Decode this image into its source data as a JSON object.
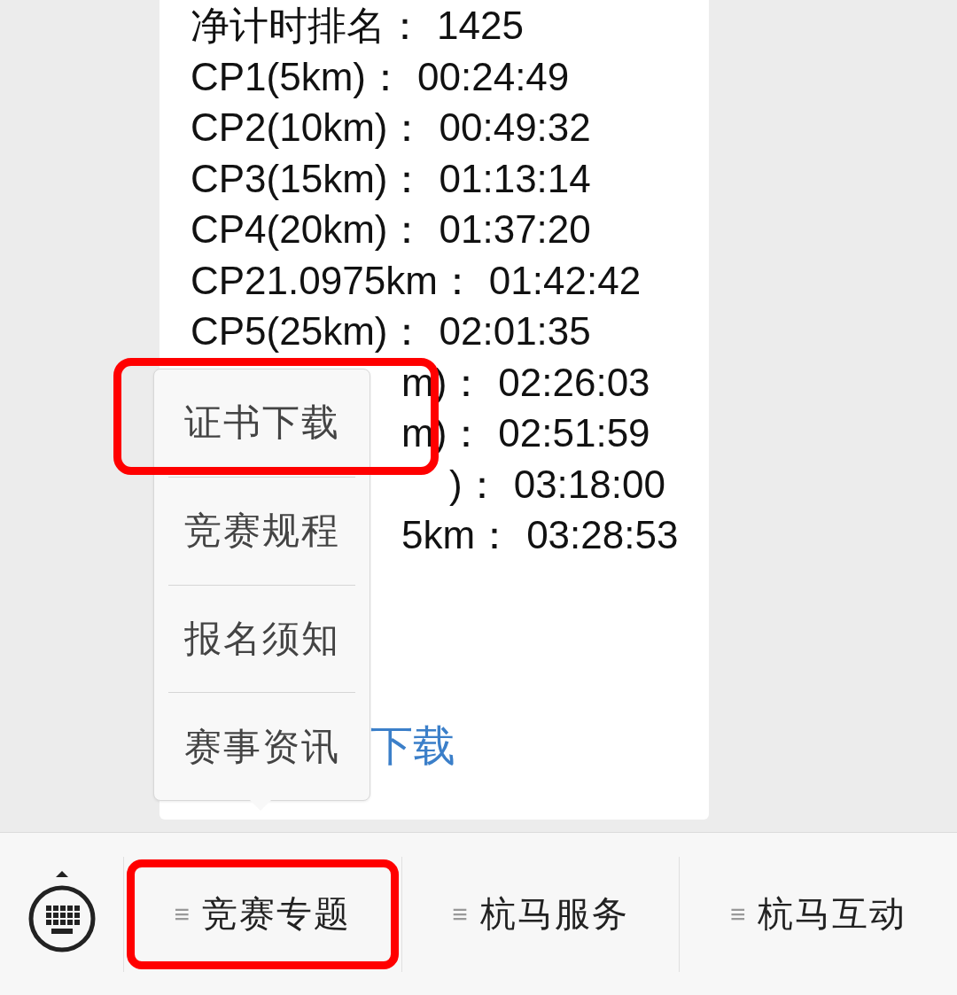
{
  "message": {
    "lines": [
      {
        "kind": "full",
        "label": "净计时排名：",
        "value": "1425"
      },
      {
        "kind": "full",
        "label": "CP1(5km)：",
        "value": "00:24:49"
      },
      {
        "kind": "full",
        "label": "CP2(10km)：",
        "value": "00:49:32"
      },
      {
        "kind": "full",
        "label": "CP3(15km)：",
        "value": "01:13:14"
      },
      {
        "kind": "full",
        "label": "CP4(20km)：",
        "value": "01:37:20"
      },
      {
        "kind": "full",
        "label": "CP21.0975km：",
        "value": "01:42:42"
      },
      {
        "kind": "full",
        "label": "CP5(25km)：",
        "value": "02:01:35"
      },
      {
        "kind": "covered",
        "label": "m)：",
        "value": "02:26:03"
      },
      {
        "kind": "covered",
        "label": "m)：",
        "value": "02:51:59"
      },
      {
        "kind": "covered",
        "label": ")：",
        "value": "03:18:00"
      },
      {
        "kind": "covered",
        "label": "5km：",
        "value": "03:28:53"
      }
    ],
    "link": "下载"
  },
  "popup_menu": {
    "items": [
      {
        "label": "证书下载",
        "highlighted": true
      },
      {
        "label": "竞赛规程",
        "highlighted": false
      },
      {
        "label": "报名须知",
        "highlighted": false
      },
      {
        "label": "赛事资讯",
        "highlighted": false
      }
    ]
  },
  "bottom_menu": {
    "tabs": [
      {
        "icon": "≡",
        "label": "竞赛专题",
        "highlighted": true
      },
      {
        "icon": "≡",
        "label": "杭马服务",
        "highlighted": false
      },
      {
        "icon": "≡",
        "label": "杭马互动",
        "highlighted": false
      }
    ]
  }
}
